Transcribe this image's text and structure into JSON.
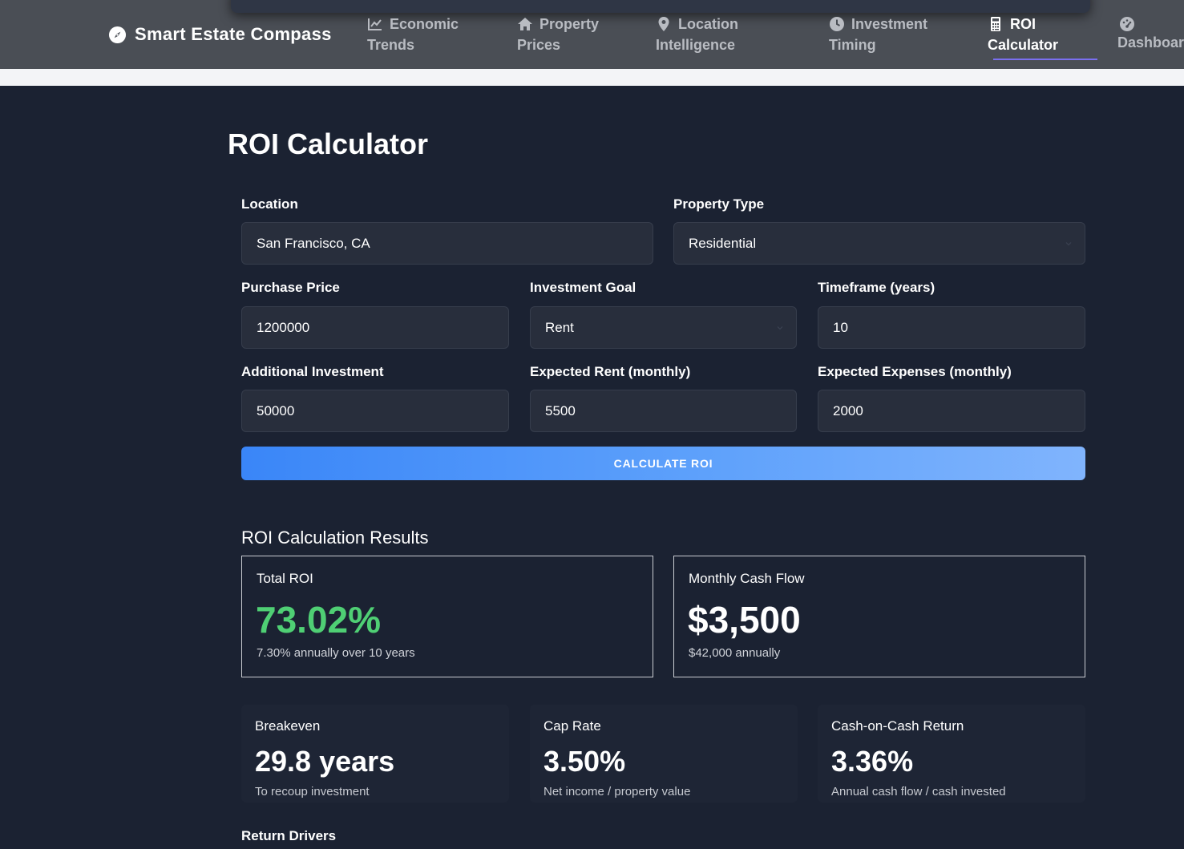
{
  "app": {
    "name": "Smart Estate Compass",
    "logo_icon": "compass-icon"
  },
  "nav": {
    "items": [
      {
        "line1": "Economic",
        "line2": "Trends",
        "icon": "chart-line-icon",
        "active": false
      },
      {
        "line1": "Property",
        "line2": "Prices",
        "icon": "home-icon",
        "active": false
      },
      {
        "line1": "Location",
        "line2": "Intelligence",
        "icon": "map-pin-icon",
        "active": false
      },
      {
        "line1": "Investment",
        "line2": "Timing",
        "icon": "clock-icon",
        "active": false
      },
      {
        "line1": "ROI",
        "line2": "Calculator",
        "icon": "calculator-icon",
        "active": true
      },
      {
        "line1": "Dashboard",
        "line2": "",
        "icon": "gauge-icon",
        "active": false
      }
    ],
    "active_color": "#7a6ff0"
  },
  "page": {
    "title": "ROI Calculator"
  },
  "form": {
    "location": {
      "label": "Location",
      "value": "San Francisco, CA"
    },
    "property_type": {
      "label": "Property Type",
      "value": "Residential"
    },
    "purchase_price": {
      "label": "Purchase Price",
      "value": "1200000"
    },
    "investment_goal": {
      "label": "Investment Goal",
      "value": "Rent"
    },
    "timeframe": {
      "label": "Timeframe (years)",
      "value": "10"
    },
    "additional_investment": {
      "label": "Additional Investment",
      "value": "50000"
    },
    "expected_rent": {
      "label": "Expected Rent (monthly)",
      "value": "5500"
    },
    "expected_expenses": {
      "label": "Expected Expenses (monthly)",
      "value": "2000"
    },
    "calculate_label": "CALCULATE ROI"
  },
  "results": {
    "title": "ROI Calculation Results",
    "total_roi": {
      "label": "Total ROI",
      "value": "73.02%",
      "sub": "7.30% annually over 10 years",
      "color": "#4fcf74"
    },
    "cash_flow": {
      "label": "Monthly Cash Flow",
      "value": "$3,500",
      "sub": "$42,000 annually"
    },
    "breakeven": {
      "label": "Breakeven",
      "value": "29.8 years",
      "sub": "To recoup investment"
    },
    "cap_rate": {
      "label": "Cap Rate",
      "value": "3.50%",
      "sub": "Net income / property value"
    },
    "coc_return": {
      "label": "Cash-on-Cash Return",
      "value": "3.36%",
      "sub": "Annual cash flow / cash invested"
    },
    "drivers_title": "Return Drivers"
  },
  "theme": {
    "background": "#1b2232",
    "navbar": "#4a4e55",
    "accent_button_start": "#3a86f8",
    "accent_button_end": "#80b4fd",
    "positive": "#4fcf74"
  }
}
